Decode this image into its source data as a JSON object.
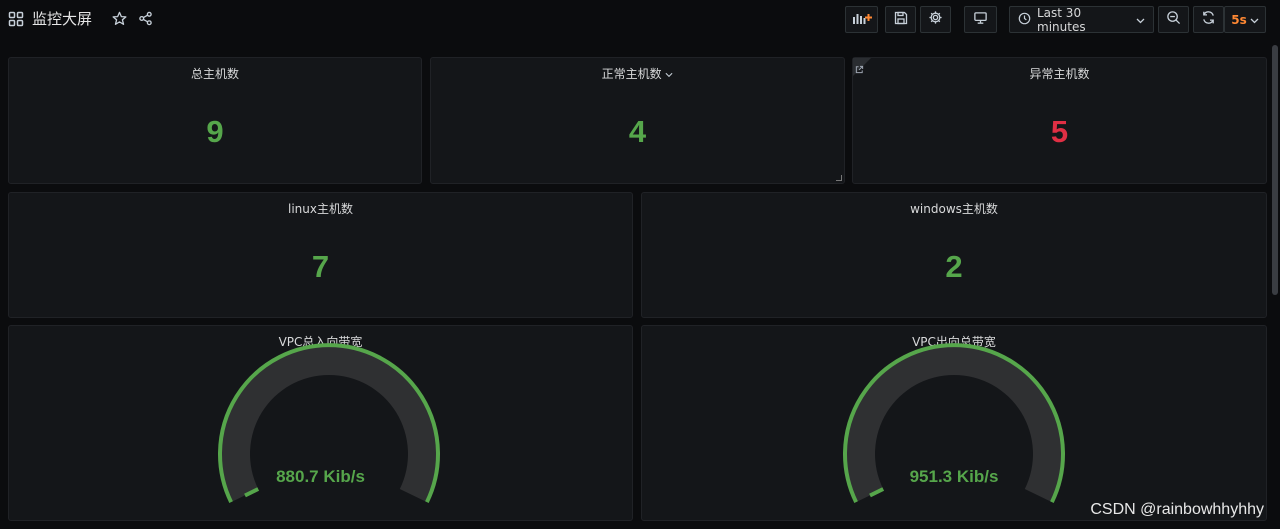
{
  "header": {
    "title": "监控大屏",
    "time_range": "Last 30 minutes",
    "refresh_interval": "5s"
  },
  "icons": {
    "dashboard": "grid-icon",
    "star": "star-icon",
    "share": "share-icon",
    "add_panel": "add-panel-icon",
    "save": "save-icon",
    "settings": "gear-icon",
    "tv_mode": "monitor-icon",
    "clock": "clock-icon",
    "zoom_out": "zoom-out-icon",
    "refresh": "refresh-icon"
  },
  "panels": {
    "total_hosts": {
      "title": "总主机数",
      "value": "9"
    },
    "normal_hosts": {
      "title": "正常主机数",
      "value": "4"
    },
    "abnormal_hosts": {
      "title": "异常主机数",
      "value": "5"
    },
    "linux_hosts": {
      "title": "linux主机数",
      "value": "7"
    },
    "windows_hosts": {
      "title": "windows主机数",
      "value": "2"
    },
    "vpc_in": {
      "title": "VPC总入向带宽",
      "value": "880.7 Kib/s",
      "fraction": 1.0
    },
    "vpc_out": {
      "title": "VPC出向总带宽",
      "value": "951.3 Kib/s",
      "fraction": 1.0
    }
  },
  "colors": {
    "ok": "#56a64b",
    "alert": "#e02f44",
    "accent": "#ff8833"
  },
  "watermark": "CSDN @rainbowhhyhhy"
}
